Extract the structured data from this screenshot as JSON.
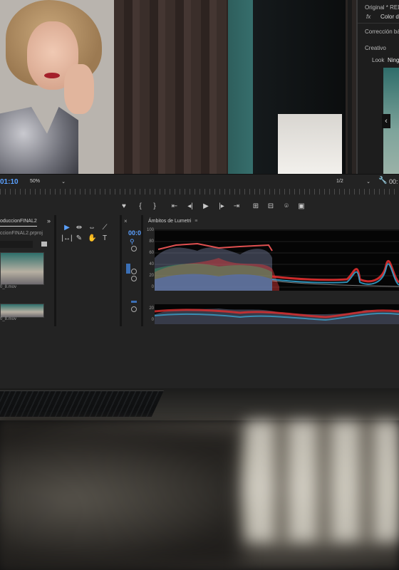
{
  "side_panel": {
    "source_label": "Original * RED_",
    "fx_label": "fx",
    "effect_label": "Color de",
    "section_basic": "Corrección básic",
    "section_creative": "Creativo",
    "look_label": "Look",
    "look_value": "Ning"
  },
  "monitor": {
    "timecode": "01:10",
    "zoom": "50%",
    "resolution": "1/2",
    "duration": "00:",
    "controls": [
      "♥",
      "{",
      "}",
      "⇤",
      "◂|",
      "▶",
      "|▸",
      "⇥",
      "⊞",
      "⊟",
      "⌾",
      "▣"
    ]
  },
  "project": {
    "title": "oduccionFINAL2",
    "file": "ccionFINAL2.prproj",
    "more": "»",
    "clips": [
      {
        "name": "0_8.mov"
      },
      {
        "name": "0_8.mov"
      }
    ]
  },
  "tools": {
    "items": [
      "▶",
      "⇹",
      "⇔",
      "⟋",
      "|↔|",
      "✎",
      "✋",
      "T"
    ]
  },
  "timeline": {
    "timecode": "00:0",
    "close": "×"
  },
  "scopes": {
    "title": "Ámbitos de Lumetri",
    "menu": "≡",
    "y_labels": [
      "100",
      "80",
      "60",
      "40",
      "20",
      "0"
    ],
    "y_labels_small": [
      "20",
      "0"
    ]
  }
}
